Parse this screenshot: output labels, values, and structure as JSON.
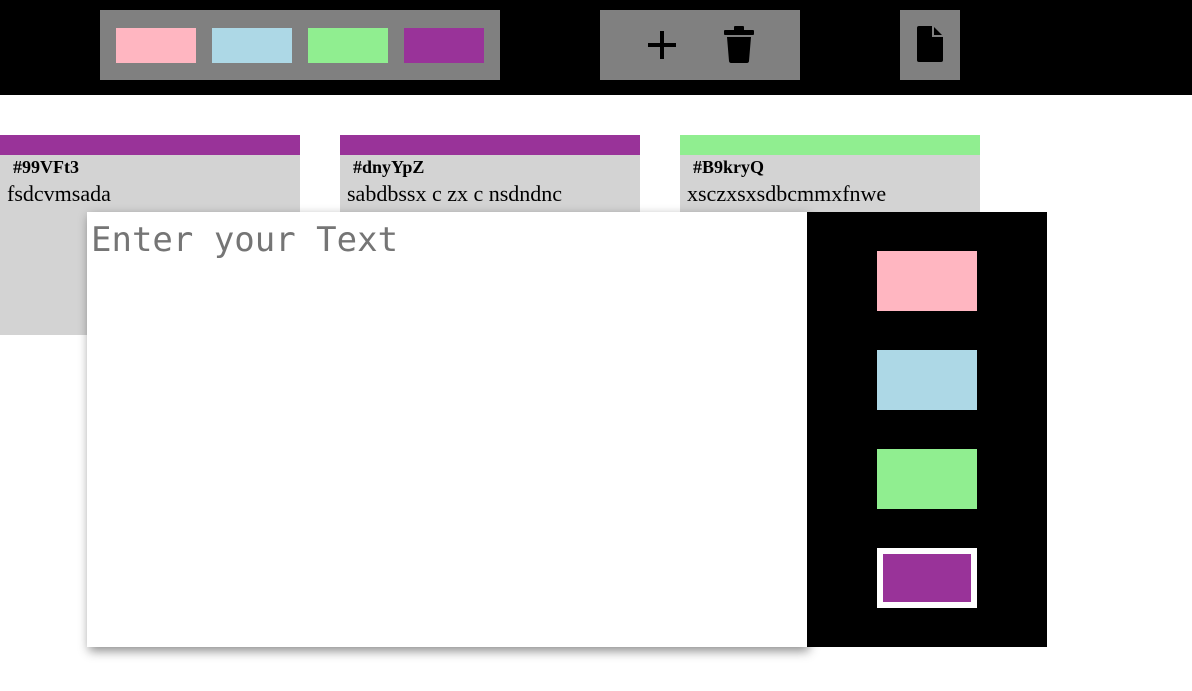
{
  "colors": {
    "pink": "#ffb6c1",
    "lightblue": "#add8e6",
    "lightgreen": "#90ee90",
    "purple": "#993399"
  },
  "toolbar": {
    "filters": [
      "pink",
      "lightblue",
      "lightgreen",
      "purple"
    ],
    "add_icon": "plus-icon",
    "delete_icon": "trash-icon",
    "file_icon": "document-icon"
  },
  "tickets": [
    {
      "id": "#99VFt3",
      "text": "fsdcvmsada",
      "color": "purple"
    },
    {
      "id": "#dnyYpZ",
      "text": "sabdbssx c zx c nsdndnc",
      "color": "purple"
    },
    {
      "id": "#B9kryQ",
      "text": "xsczxsxsdbcmmxfnwe",
      "color": "lightgreen"
    }
  ],
  "modal": {
    "placeholder": "Enter your Text",
    "value": "",
    "priority_colors": [
      "pink",
      "lightblue",
      "lightgreen",
      "purple"
    ],
    "selected_color": "purple"
  }
}
